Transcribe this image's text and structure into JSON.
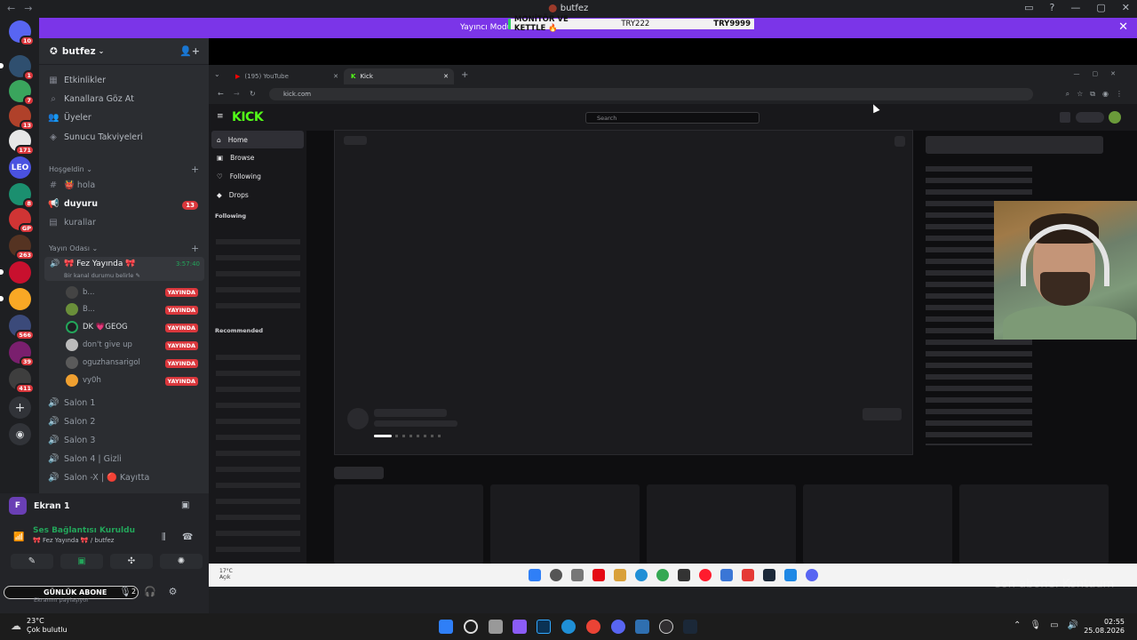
{
  "window": {
    "title": "butfez",
    "nav_back": "←",
    "nav_fwd": "→"
  },
  "banner": {
    "text": "Yayıncı Modu",
    "overlay_item1": "MONİTÖR VE KETTLE 🔥",
    "overlay_item2": "TRY222",
    "overlay_item3": "TRY9999",
    "close": "✕"
  },
  "servers": [
    {
      "badge": "10"
    },
    {
      "badge": "1"
    },
    {
      "badge": "7"
    },
    {
      "badge": "13"
    },
    {
      "badge": "171"
    },
    {
      "label": "LEO",
      "badge": ""
    },
    {
      "badge": "8"
    },
    {
      "badge": "GP"
    },
    {
      "badge": "263"
    },
    {
      "badge": ""
    },
    {
      "badge": ""
    },
    {
      "badge": "566"
    },
    {
      "badge": "39"
    },
    {
      "badge": "411"
    }
  ],
  "server_name": "butfez",
  "menu": [
    {
      "icon": "▦",
      "label": "Etkinlikler"
    },
    {
      "icon": "⌕",
      "label": "Kanallara Göz At"
    },
    {
      "icon": "👥",
      "label": "Üyeler"
    },
    {
      "icon": "◈",
      "label": "Sunucu Takviyeleri"
    }
  ],
  "categories": {
    "welcome": "Hoşgeldin",
    "stream_room": "Yayın Odası"
  },
  "text_channels": [
    {
      "icon": "#",
      "label": "👹 hola"
    },
    {
      "icon": "📢",
      "label": "duyuru",
      "badge": "13"
    },
    {
      "icon": "▤",
      "label": "kurallar"
    }
  ],
  "active_voice": {
    "label": "🎀 Fez Yayında 🎀",
    "status": "Bir kanal durumu belirle ✎",
    "timer": "3:57:40"
  },
  "voice_users": [
    {
      "name": "b...",
      "live": "YAYINDA"
    },
    {
      "name": "B...",
      "live": "YAYINDA"
    },
    {
      "name": "DK 💗GEOG",
      "live": "YAYINDA"
    },
    {
      "name": "don't give up",
      "live": "YAYINDA"
    },
    {
      "name": "oguzhansarigol",
      "live": "YAYINDA"
    },
    {
      "name": "vy0h",
      "live": "YAYINDA"
    }
  ],
  "voice_channels": [
    "Salon 1",
    "Salon 2",
    "Salon 3",
    "Salon 4 | Gizli",
    "Salon -X | 🔴 Kayıtta"
  ],
  "panel": {
    "screen": "Ekran 1",
    "screen_icon": "F",
    "voice_title": "Ses Bağlantısı Kuruldu",
    "voice_sub": "🎀 Fez Yayında 🎀 / butfez",
    "sub_label": "GÜNLÜK ABONE",
    "sub_count": "2",
    "sub_status": "Ekranını paylaşıyor"
  },
  "browser": {
    "tab1": "(195) YouTube",
    "tab2": "Kick",
    "url": "kick.com",
    "new_tab": "+"
  },
  "kick": {
    "logo": "KICK",
    "search_placeholder": "Search",
    "nav": [
      "Home",
      "Browse",
      "Following",
      "Drops"
    ],
    "following": "Following",
    "recommended": "Recommended"
  },
  "inner_taskbar": {
    "weather": "17°C",
    "weather_sub": "Açık"
  },
  "taskbar": {
    "temp": "23°C",
    "condition": "Çok bulutlu",
    "time": "02:55",
    "date": "25.08.2026"
  },
  "overlay_text": "son abone: Kontuum"
}
